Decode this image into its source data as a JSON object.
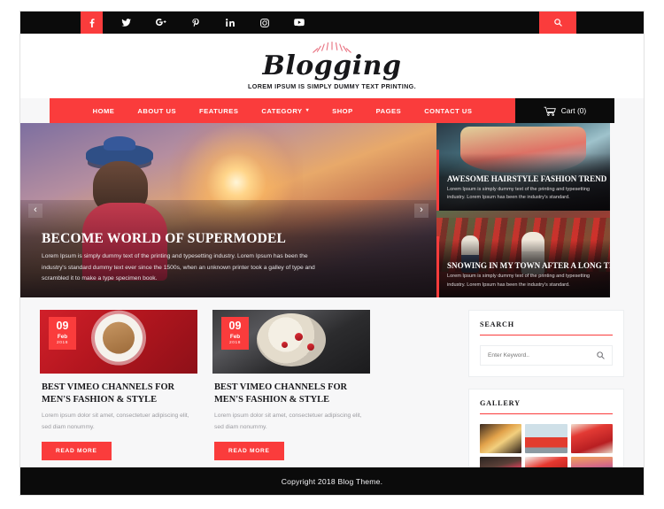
{
  "topbar": {
    "social": [
      {
        "name": "facebook-icon",
        "glyph": "f",
        "active": true
      },
      {
        "name": "twitter-icon",
        "glyph": "t",
        "active": false
      },
      {
        "name": "google-plus-icon",
        "glyph": "G+",
        "active": false
      },
      {
        "name": "pinterest-icon",
        "glyph": "P",
        "active": false
      },
      {
        "name": "linkedin-icon",
        "glyph": "in",
        "active": false
      },
      {
        "name": "instagram-icon",
        "glyph": "ig",
        "active": false
      },
      {
        "name": "youtube-icon",
        "glyph": "yt",
        "active": false
      }
    ],
    "search_icon": "search-icon"
  },
  "logo": {
    "name": "Blogging",
    "tagline": "LOREM IPSUM IS SIMPLY DUMMY TEXT PRINTING."
  },
  "nav": {
    "items": [
      {
        "label": "HOME",
        "has_dropdown": false
      },
      {
        "label": "ABOUT US",
        "has_dropdown": false
      },
      {
        "label": "FEATURES",
        "has_dropdown": false
      },
      {
        "label": "CATEGORY",
        "has_dropdown": true
      },
      {
        "label": "SHOP",
        "has_dropdown": false
      },
      {
        "label": "PAGES",
        "has_dropdown": false
      },
      {
        "label": "CONTACT US",
        "has_dropdown": false
      }
    ],
    "dropdown_glyph": "▾",
    "cart_label": "Cart (0)"
  },
  "hero": {
    "title": "BECOME WORLD OF SUPERMODEL",
    "description": "Lorem Ipsum is simply dummy text of the printing and typesetting industry. Lorem Ipsum has been the industry's standard dummy text ever since the 1500s, when an unknown printer took a galley of type and scrambled it to make a type specimen book.",
    "prev_glyph": "‹",
    "next_glyph": "›",
    "side_cards": [
      {
        "title": "AWESOME HAIRSTYLE FASHION TREND",
        "description": "Lorem Ipsum is simply dummy text of the printing and typesetting industry. Lorem Ipsum has been the industry's standard."
      },
      {
        "title": "SNOWING IN MY TOWN AFTER A LONG TIME",
        "description": "Lorem Ipsum is simply dummy text of the printing and typesetting industry. Lorem Ipsum has been the industry's standard."
      }
    ]
  },
  "posts": [
    {
      "day": "09",
      "month": "Feb",
      "year": "2018",
      "title": "BEST VIMEO CHANNELS FOR MEN'S FASHION & STYLE",
      "excerpt": "Lorem ipsum dolor sit amet, consectetuer adipiscing elit, sed diam nonummy.",
      "button_label": "READ MORE"
    },
    {
      "day": "09",
      "month": "Feb",
      "year": "2018",
      "title": "BEST VIMEO CHANNELS FOR MEN'S FASHION & STYLE",
      "excerpt": "Lorem ipsum dolor sit amet, consectetuer adipiscing elit, sed diam nonummy.",
      "button_label": "READ MORE"
    }
  ],
  "sidebar": {
    "search": {
      "title": "SEARCH",
      "placeholder": "Enter Keyword..",
      "value": "",
      "icon": "search-icon"
    },
    "gallery": {
      "title": "GALLERY",
      "items": [
        "gallery-thumb-pastry",
        "gallery-thumb-red-car",
        "gallery-thumb-strawberry-heart",
        "gallery-thumb-cocktail",
        "gallery-thumb-strawberry",
        "gallery-thumb-kayak-sunset"
      ]
    }
  },
  "footer": {
    "copyright": "Copyright 2018 Blog Theme."
  },
  "colors": {
    "accent": "#fa3c3c",
    "dark": "#0b0b0b",
    "page_bg": "#f7f7f8"
  }
}
